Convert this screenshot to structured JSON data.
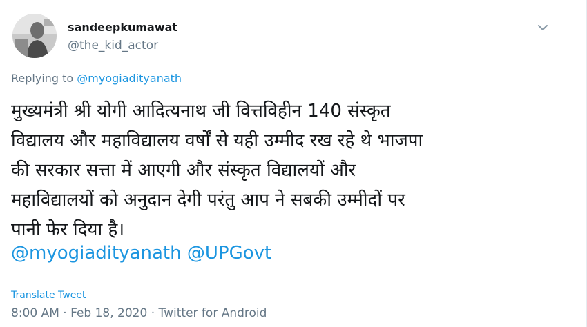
{
  "user": {
    "display_name": "sandeepkumawat",
    "handle": "@the_kid_actor",
    "avatar_icon": "profile-photo"
  },
  "reply": {
    "prefix": "Replying to",
    "mention": "@myogiadityanath"
  },
  "tweet": {
    "lines": [
      "मुख्यमंत्री श्री योगी आदित्यनाथ जी वित्तविहीन 140 संस्कृत",
      "विद्यालय और महाविद्यालय वर्षों से यही उम्मीद रख रहे थे भाजपा",
      "की सरकार सत्ता में आएगी और संस्कृत विद्यालयों और",
      "महाविद्यालयों को  अनुदान देगी परंतु आप ने सबकी उम्मीदों पर",
      "पानी फेर दिया है।"
    ],
    "mentions": [
      "@myogiadityanath",
      "@UPGovt"
    ]
  },
  "translate_label": "Translate Tweet",
  "meta": {
    "time": "8:00 AM",
    "separator1": " · ",
    "date": "Feb 18, 2020",
    "separator2": " · ",
    "source": "Twitter for Android"
  },
  "colors": {
    "link": "#1b95e0",
    "secondary_text": "#657786",
    "primary_text": "#14171a"
  }
}
